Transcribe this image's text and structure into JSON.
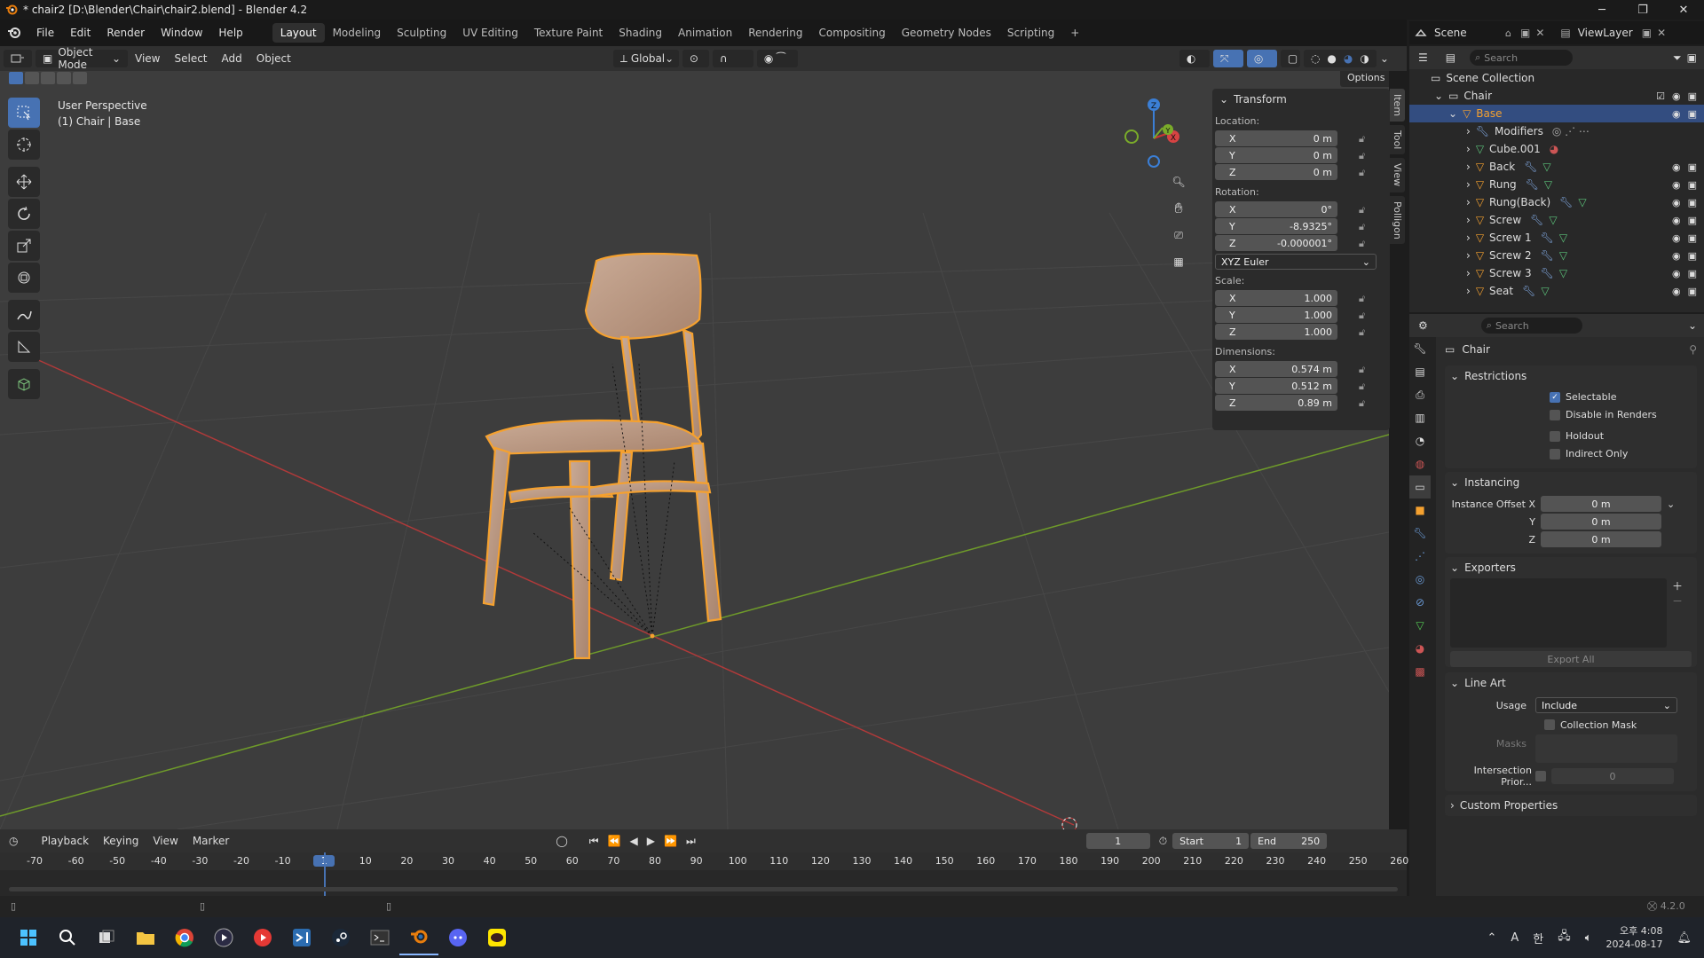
{
  "window": {
    "title": "* chair2 [D:\\Blender\\Chair\\chair2.blend] - Blender 4.2",
    "min": "─",
    "max": "❐",
    "close": "✕"
  },
  "menu": [
    "File",
    "Edit",
    "Render",
    "Window",
    "Help"
  ],
  "workspaces": [
    "Layout",
    "Modeling",
    "Sculpting",
    "UV Editing",
    "Texture Paint",
    "Shading",
    "Animation",
    "Rendering",
    "Compositing",
    "Geometry Nodes",
    "Scripting",
    "+"
  ],
  "scene": {
    "name": "Scene",
    "view_layer": "ViewLayer"
  },
  "viewport_header": {
    "mode": "Object Mode",
    "menus": [
      "View",
      "Select",
      "Add",
      "Object"
    ],
    "orientation": "Global",
    "options": "Options"
  },
  "overlay_text": {
    "line1": "User Perspective",
    "line2": "(1) Chair | Base"
  },
  "gizmo": {
    "z": "Z",
    "x": "X",
    "y": "Y"
  },
  "npanel": {
    "title": "Transform",
    "location_label": "Location:",
    "location": [
      {
        "axis": "X",
        "value": "0 m"
      },
      {
        "axis": "Y",
        "value": "0 m"
      },
      {
        "axis": "Z",
        "value": "0 m"
      }
    ],
    "rotation_label": "Rotation:",
    "rotation": [
      {
        "axis": "X",
        "value": "0°"
      },
      {
        "axis": "Y",
        "value": "-8.9325°"
      },
      {
        "axis": "Z",
        "value": "-0.000001°"
      }
    ],
    "rotation_mode": "XYZ Euler",
    "scale_label": "Scale:",
    "scale": [
      {
        "axis": "X",
        "value": "1.000"
      },
      {
        "axis": "Y",
        "value": "1.000"
      },
      {
        "axis": "Z",
        "value": "1.000"
      }
    ],
    "dimensions_label": "Dimensions:",
    "dimensions": [
      {
        "axis": "X",
        "value": "0.574 m"
      },
      {
        "axis": "Y",
        "value": "0.512 m"
      },
      {
        "axis": "Z",
        "value": "0.89 m"
      }
    ],
    "tabs": [
      "Item",
      "Tool",
      "View",
      "Polligon"
    ]
  },
  "outliner": {
    "search_placeholder": "Search",
    "root": "Scene Collection",
    "collection": "Chair",
    "selected": "Base",
    "children": [
      "Modifiers",
      "Cube.001",
      "Back",
      "Rung",
      "Rung(Back)",
      "Screw",
      "Screw 1",
      "Screw 2",
      "Screw 3",
      "Seat"
    ]
  },
  "properties": {
    "search_placeholder": "Search",
    "object": "Chair",
    "restrictions": {
      "title": "Restrictions",
      "selectable": "Selectable",
      "disable_renders": "Disable in Renders",
      "holdout": "Holdout",
      "indirect_only": "Indirect Only"
    },
    "instancing": {
      "title": "Instancing",
      "offset_x_label": "Instance Offset X",
      "y_label": "Y",
      "z_label": "Z",
      "x": "0 m",
      "y": "0 m",
      "z": "0 m"
    },
    "exporters": {
      "title": "Exporters",
      "export_all": "Export All"
    },
    "line_art": {
      "title": "Line Art",
      "usage_label": "Usage",
      "usage": "Include",
      "collection_mask": "Collection Mask",
      "masks": "Masks",
      "intersection_label": "Intersection Prior...",
      "intersection_value": "0"
    },
    "custom_properties": "Custom Properties"
  },
  "timeline": {
    "menus": [
      "Playback",
      "Keying",
      "View",
      "Marker"
    ],
    "current_frame": "1",
    "start_label": "Start",
    "start": "1",
    "end_label": "End",
    "end": "250",
    "ruler": [
      "-70",
      "-60",
      "-50",
      "-40",
      "-30",
      "-20",
      "-10",
      "1",
      "10",
      "20",
      "30",
      "40",
      "50",
      "60",
      "70",
      "80",
      "90",
      "100",
      "110",
      "120",
      "130",
      "140",
      "150",
      "160",
      "170",
      "180",
      "190",
      "200",
      "210",
      "220",
      "230",
      "240",
      "250",
      "260"
    ]
  },
  "status": {
    "version": "4.2.0"
  },
  "taskbar": {
    "ime": "A",
    "lang": "한",
    "time": "오후 4:08",
    "date": "2024-08-17"
  },
  "colors": {
    "accent": "#4772b3",
    "selection_orange": "#f5a12f",
    "x_axis": "#b03a3a",
    "y_axis": "#6e9a2a",
    "wood": "#b89682"
  }
}
